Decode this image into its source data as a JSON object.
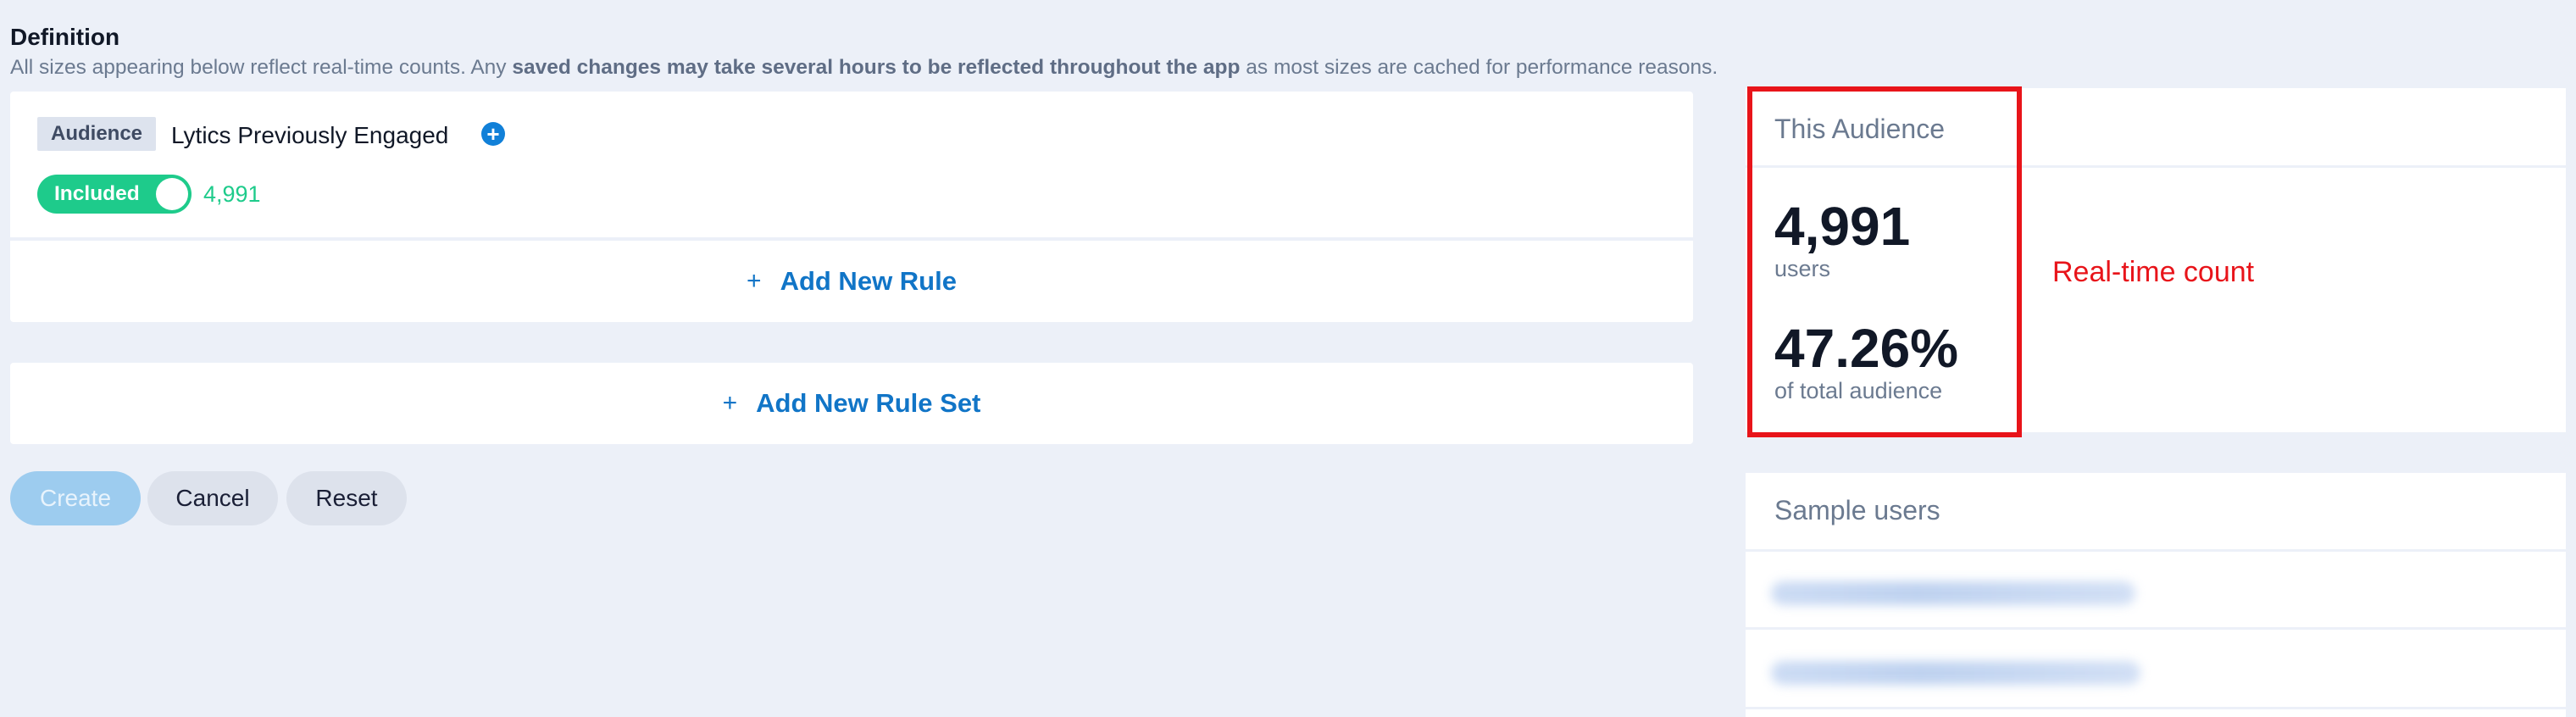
{
  "definition": {
    "title": "Definition",
    "desc_prefix": "All sizes appearing below reflect real-time counts. Any ",
    "desc_bold": "saved changes may take several hours to be reflected throughout the app",
    "desc_suffix": " as most sizes are cached for performance reasons."
  },
  "ruleset": {
    "badge": "Audience",
    "rule_name": "Lytics Previously Engaged",
    "info_icon": "plus-circle-icon",
    "toggle_label": "Included",
    "count": "4,991",
    "add_rule_plus": "+",
    "add_rule_label": "Add New Rule"
  },
  "add_ruleset": {
    "plus": "+",
    "label": "Add New Rule Set"
  },
  "buttons": {
    "create": "Create",
    "cancel": "Cancel",
    "reset": "Reset"
  },
  "this_audience": {
    "title": "This Audience",
    "users_value": "4,991",
    "users_label": "users",
    "percent_value": "47.26%",
    "percent_label": "of total audience"
  },
  "annotation": {
    "text": "Real-time count",
    "color": "#e8141a"
  },
  "sample_users": {
    "title": "Sample users"
  },
  "colors": {
    "accent_blue": "#1175c7",
    "included_green": "#1ecb8b",
    "background": "#ecf0f8"
  }
}
